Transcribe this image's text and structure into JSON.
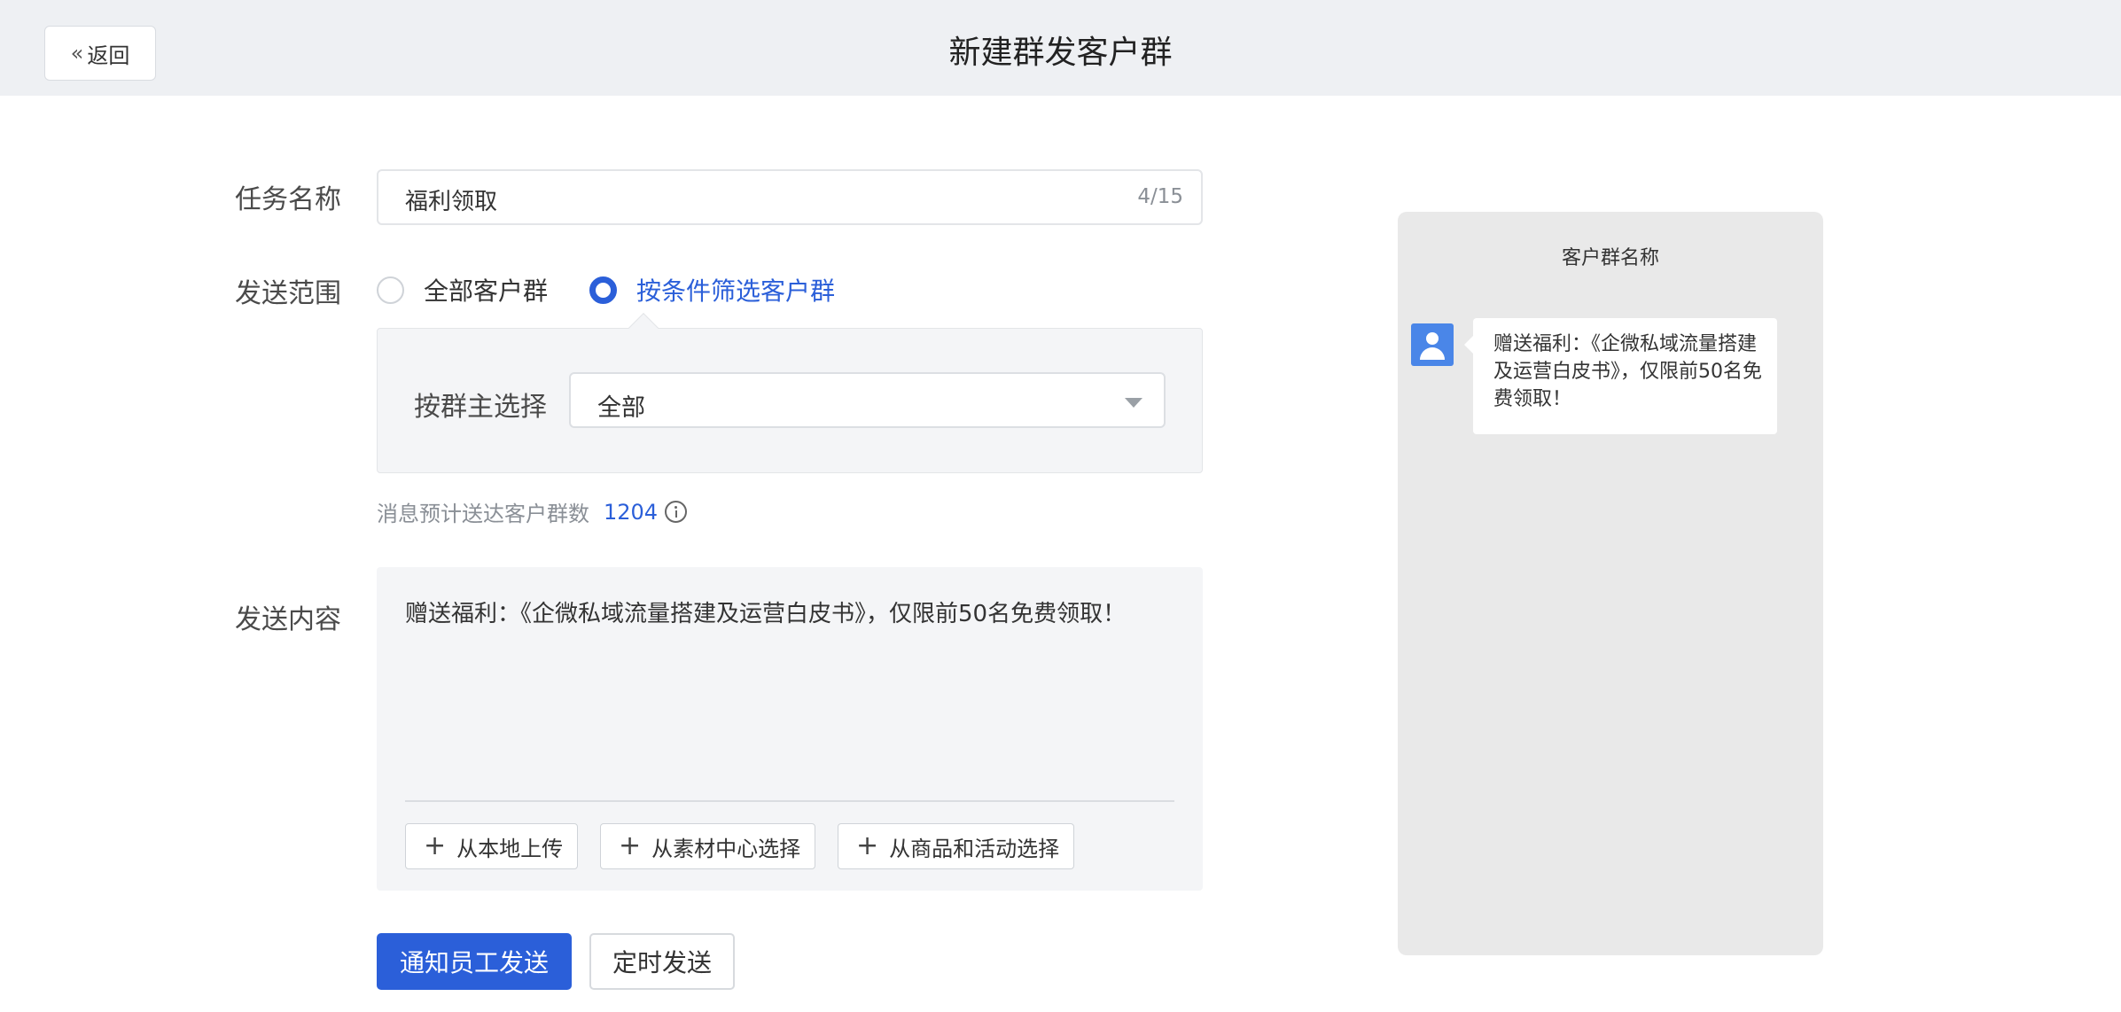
{
  "header": {
    "back_label": "返回",
    "title": "新建群发客户群"
  },
  "form": {
    "task_name": {
      "label": "任务名称",
      "value": "福利领取",
      "counter": "4/15"
    },
    "send_scope": {
      "label": "发送范围",
      "options": [
        {
          "label": "全部客户群",
          "checked": false
        },
        {
          "label": "按条件筛选客户群",
          "checked": true
        }
      ],
      "filter": {
        "label": "按群主选择",
        "selected": "全部"
      },
      "estimate_label": "消息预计送达客户群数",
      "estimate_value": "1204"
    },
    "content": {
      "label": "发送内容",
      "text": "赠送福利：《企微私域流量搭建及运营白皮书》，仅限前50名免费领取！",
      "add_buttons": [
        "从本地上传",
        "从素材中心选择",
        "从商品和活动选择"
      ]
    },
    "actions": {
      "primary": "通知员工发送",
      "secondary": "定时发送"
    }
  },
  "preview": {
    "title": "客户群名称",
    "message": "赠送福利：《企微私域流量搭建及运营白皮书》，仅限前50名免费领取！"
  },
  "colors": {
    "accent": "#2b5fd9",
    "header_bg": "#eef0f3",
    "panel_bg": "#f4f5f7",
    "preview_bg": "#e9e9e9",
    "avatar": "#4a86e8"
  }
}
